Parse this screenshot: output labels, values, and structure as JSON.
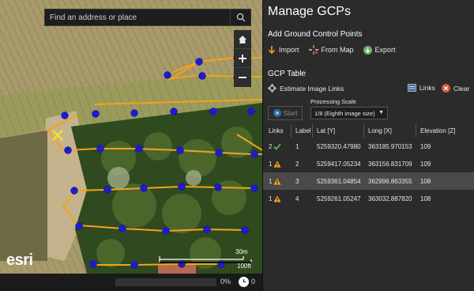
{
  "search": {
    "placeholder": "Find an address or place"
  },
  "map": {
    "logo": "esri",
    "scale_labels": [
      "30m",
      "100ft"
    ],
    "progress_percent": 0,
    "progress_text": "0%",
    "status_count": "0",
    "colors": {
      "flight_line": "#f5a21b",
      "point": "#1b1bd6",
      "gcp_marker": "#f7e02a"
    }
  },
  "panel": {
    "title": "Manage GCPs",
    "add_section": "Add Ground Control Points",
    "actions": {
      "import": "Import",
      "from_map": "From Map",
      "export": "Export"
    },
    "table_section": "GCP Table",
    "estimate": "Estimate Image Links",
    "links": "Links",
    "clear": "Clear",
    "start": "Start",
    "processing_scale_label": "Processing Scale",
    "processing_scale_value": "1/8 (Eighth image size)"
  },
  "table": {
    "headers": [
      "Links",
      "Label",
      "Lat [Y]",
      "Long [X]",
      "Elevation [Z]"
    ],
    "rows": [
      {
        "links": "2",
        "status": "check",
        "label": "1",
        "lat": "5259320.47980",
        "long": "363185.970153",
        "elev": "109"
      },
      {
        "links": "1",
        "status": "warning",
        "label": "2",
        "lat": "5259417.05234",
        "long": "363156.831709",
        "elev": "109"
      },
      {
        "links": "1",
        "status": "warning",
        "label": "3",
        "lat": "5259361.04854",
        "long": "362996.863355",
        "elev": "108"
      },
      {
        "links": "1",
        "status": "warning",
        "label": "4",
        "lat": "5259261.05247",
        "long": "363032.887820",
        "elev": "108"
      }
    ]
  }
}
